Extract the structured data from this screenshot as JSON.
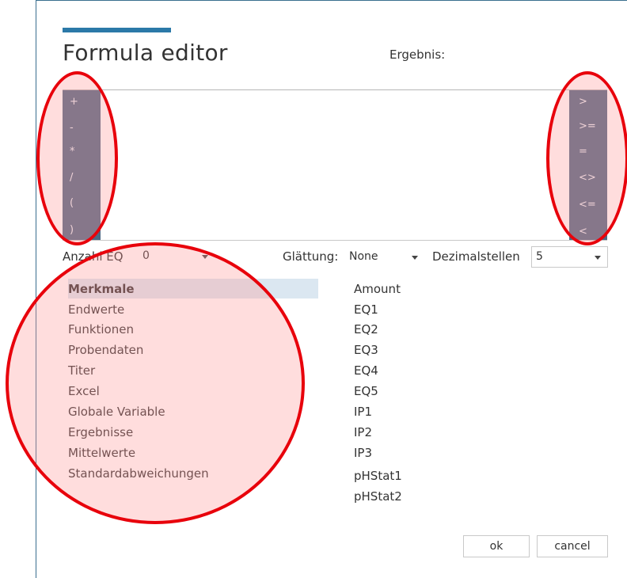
{
  "dialog": {
    "title": "Formula editor",
    "result_label": "Ergebnis:"
  },
  "operators_left": [
    "+",
    "-",
    "*",
    "/",
    "(",
    ")"
  ],
  "operators_right": [
    ">",
    ">=",
    "=",
    "<>",
    "<=",
    "<"
  ],
  "controls": {
    "anzahl_eq_label": "Anzahl EQ",
    "anzahl_eq_value": "0",
    "glaettung_label": "Glättung:",
    "glaettung_value": "None",
    "dezimalstellen_label": "Dezimalstellen",
    "dezimalstellen_value": "5"
  },
  "categories": [
    "Merkmale",
    "Endwerte",
    "Funktionen",
    "Probendaten",
    "Titer",
    "Excel",
    "Globale Variable",
    "Ergebnisse",
    "Mittelwerte",
    "Standardabweichungen"
  ],
  "selected_category": "Merkmale",
  "variables": [
    "Amount",
    "EQ1",
    "EQ2",
    "EQ3",
    "EQ4",
    "EQ5",
    "IP1",
    "IP2",
    "IP3",
    "pHStat1",
    "pHStat2"
  ],
  "buttons": {
    "ok": "ok",
    "cancel": "cancel"
  },
  "colors": {
    "accent": "#2b79a8",
    "operator_panel": "#4d6985",
    "selection": "#dbe7f1",
    "annotation": "#e8000b"
  }
}
